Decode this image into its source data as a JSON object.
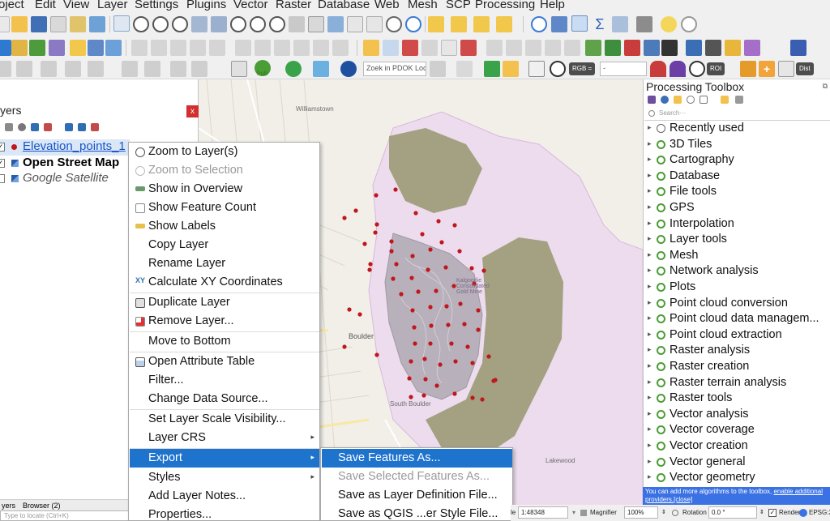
{
  "menubar": [
    "oject",
    "Edit",
    "View",
    "Layer",
    "Settings",
    "Plugins",
    "Vector",
    "Raster",
    "Database",
    "Web",
    "Mesh",
    "SCP",
    "Processing",
    "Help"
  ],
  "toolbar": {
    "search_placeholder": "Zoek in PDOK Loc···",
    "rgb_label": "RGB =",
    "rgb_value": "-",
    "roi_label": "ROI",
    "dist_label": "Dist",
    "hub_label": "hub"
  },
  "layers_panel": {
    "title": "yers",
    "close": "x",
    "items": [
      {
        "name": "Elevation_points_1",
        "checked": true
      },
      {
        "name": "Open Street Map",
        "checked": true
      },
      {
        "name": "Google Satellite",
        "checked": false
      }
    ],
    "tabs": [
      "yers",
      "Browser (2)"
    ],
    "locator_placeholder": "Type to locate (Ctrl+K)"
  },
  "context_menu": {
    "items": [
      {
        "label": "Zoom to Layer(s)",
        "icon": "zoom-layer-icon"
      },
      {
        "label": "Zoom to Selection",
        "icon": "zoom-selection-icon",
        "disabled": true
      },
      {
        "label": "Show in Overview",
        "icon": "overview-icon"
      },
      {
        "label": "Show Feature Count",
        "icon": "checkbox-icon"
      },
      {
        "label": "Show Labels",
        "icon": "labels-icon"
      },
      {
        "label": "Copy Layer"
      },
      {
        "label": "Rename Layer"
      },
      {
        "label": "Calculate XY Coordinates",
        "icon": "xy-icon"
      },
      {
        "label": "Duplicate Layer",
        "icon": "duplicate-icon"
      },
      {
        "label": "Remove Layer...",
        "icon": "remove-icon"
      },
      {
        "label": "Move to Bottom"
      },
      {
        "label": "Open Attribute Table",
        "icon": "table-icon"
      },
      {
        "label": "Filter..."
      },
      {
        "label": "Change Data Source..."
      },
      {
        "label": "Set Layer Scale Visibility..."
      },
      {
        "label": "Layer CRS",
        "submenu": true
      },
      {
        "label": "Export",
        "submenu": true,
        "active": true
      },
      {
        "label": "Styles",
        "submenu": true
      },
      {
        "label": "Add Layer Notes..."
      },
      {
        "label": "Properties..."
      }
    ]
  },
  "export_submenu": {
    "items": [
      {
        "label": "Save Features As...",
        "active": true
      },
      {
        "label": "Save Selected Features As...",
        "disabled": true
      },
      {
        "label": "Save as Layer Definition File..."
      },
      {
        "label": "Save as QGIS ...er Style File..."
      }
    ]
  },
  "processing_toolbox": {
    "title": "Processing Toolbox",
    "search_placeholder": "Search···",
    "items": [
      "Recently used",
      "3D Tiles",
      "Cartography",
      "Database",
      "File tools",
      "GPS",
      "Interpolation",
      "Layer tools",
      "Mesh",
      "Network analysis",
      "Plots",
      "Point cloud conversion",
      "Point cloud data managem...",
      "Point cloud extraction",
      "Raster analysis",
      "Raster creation",
      "Raster terrain analysis",
      "Raster tools",
      "Vector analysis",
      "Vector coverage",
      "Vector creation",
      "Vector general",
      "Vector geometry"
    ],
    "note_text": "You can add more algorithms to the toolbox, ",
    "note_link": "enable additional providers.",
    "note_close": "[close]"
  },
  "map": {
    "labels": [
      "Williamstown",
      "Boulder",
      "South Boulder",
      "Lakewood",
      "Kalgoorlie Consolidated Gold Mine"
    ],
    "point_color": "#c0161c"
  },
  "statusbar": {
    "scale_label": "le",
    "scale_value": "1:48348",
    "magnifier_label": "Magnifier",
    "magnifier_value": "100%",
    "rotation_label": "Rotation",
    "rotation_value": "0.0 °",
    "render_label": "Render",
    "crs": "EPSG:32751"
  }
}
